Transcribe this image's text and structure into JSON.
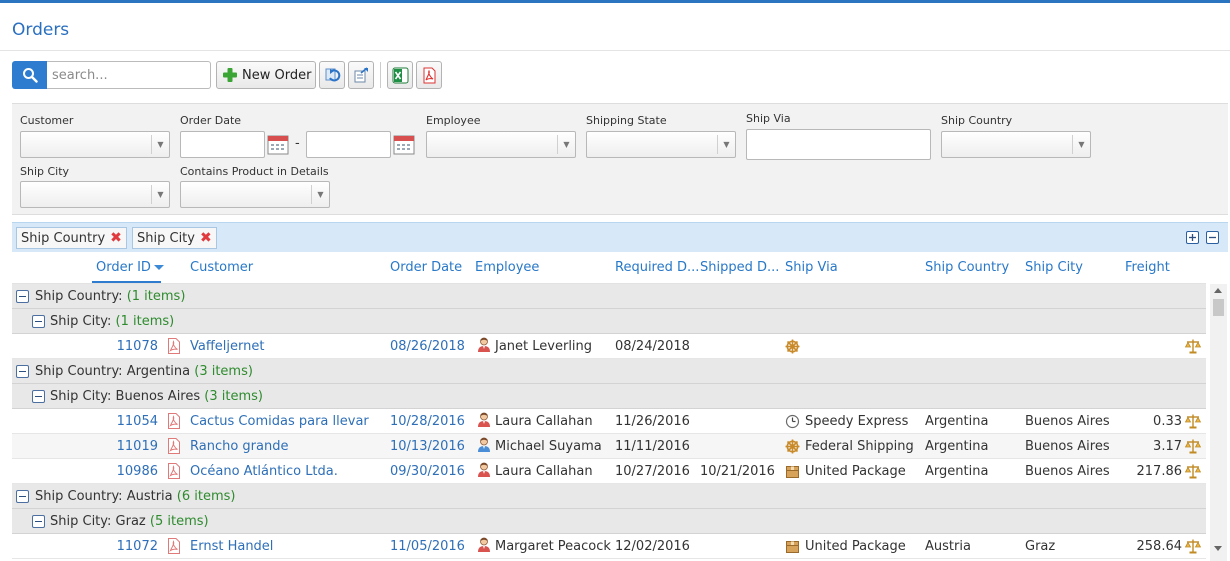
{
  "page": {
    "title": "Orders"
  },
  "toolbar": {
    "search_placeholder": "search...",
    "new_order_label": "New Order",
    "icons": [
      "search-icon",
      "plus-icon",
      "refresh-icon",
      "export-icon",
      "excel-icon",
      "pdf-icon"
    ]
  },
  "filters": {
    "customer": "Customer",
    "order_date": "Order Date",
    "date_separator": "-",
    "employee": "Employee",
    "shipping_state": "Shipping State",
    "ship_via": "Ship Via",
    "ship_country": "Ship Country",
    "ship_city": "Ship City",
    "contains_product": "Contains Product in Details"
  },
  "group_chips": [
    "Ship Country",
    "Ship City"
  ],
  "columns": {
    "order_id": "Order ID",
    "customer": "Customer",
    "order_date": "Order Date",
    "employee": "Employee",
    "required_date": "Required D...",
    "shipped_date": "Shipped D...",
    "ship_via": "Ship Via",
    "ship_country": "Ship Country",
    "ship_city": "Ship City",
    "freight": "Freight"
  },
  "groups": [
    {
      "label": "Ship Country: ",
      "value": "",
      "count": "(1 items)"
    },
    {
      "label": "Ship City: ",
      "value": "",
      "count": "(1 items)"
    },
    {
      "label": "Ship Country: ",
      "value": "Argentina ",
      "count": "(3 items)"
    },
    {
      "label": "Ship City: ",
      "value": "Buenos Aires ",
      "count": "(3 items)"
    },
    {
      "label": "Ship Country: ",
      "value": "Austria ",
      "count": "(6 items)"
    },
    {
      "label": "Ship City: ",
      "value": "Graz ",
      "count": "(5 items)"
    }
  ],
  "rows": [
    {
      "id": "11078",
      "customer": "Vaffeljernet",
      "order_date": "08/26/2018",
      "employee": "Janet Leverling",
      "emp_gender": "female",
      "required": "08/24/2018",
      "shipped": "",
      "ship_via": "",
      "ship_icon": "federal-shipping-icon",
      "country": "",
      "city": "",
      "freight": ""
    },
    {
      "id": "11054",
      "customer": "Cactus Comidas para llevar",
      "order_date": "10/28/2016",
      "employee": "Laura Callahan",
      "emp_gender": "female",
      "required": "11/26/2016",
      "shipped": "",
      "ship_via": "Speedy Express",
      "ship_icon": "speedy-express-icon",
      "country": "Argentina",
      "city": "Buenos Aires",
      "freight": "0.33"
    },
    {
      "id": "11019",
      "customer": "Rancho grande",
      "order_date": "10/13/2016",
      "employee": "Michael Suyama",
      "emp_gender": "male",
      "required": "11/11/2016",
      "shipped": "",
      "ship_via": "Federal Shipping",
      "ship_icon": "federal-shipping-icon",
      "country": "Argentina",
      "city": "Buenos Aires",
      "freight": "3.17"
    },
    {
      "id": "10986",
      "customer": "Océano Atlántico Ltda.",
      "order_date": "09/30/2016",
      "employee": "Laura Callahan",
      "emp_gender": "female",
      "required": "10/27/2016",
      "shipped": "10/21/2016",
      "ship_via": "United Package",
      "ship_icon": "united-package-icon",
      "country": "Argentina",
      "city": "Buenos Aires",
      "freight": "217.86"
    },
    {
      "id": "11072",
      "customer": "Ernst Handel",
      "order_date": "11/05/2016",
      "employee": "Margaret Peacock",
      "emp_gender": "female",
      "required": "12/02/2016",
      "shipped": "",
      "ship_via": "United Package",
      "ship_icon": "united-package-icon",
      "country": "Austria",
      "city": "Graz",
      "freight": "258.64"
    }
  ],
  "colors": {
    "accent": "#2d7cd0",
    "link": "#2e6fb8",
    "group_count": "#2e8b2e",
    "group_bar": "#d7e9f8"
  }
}
